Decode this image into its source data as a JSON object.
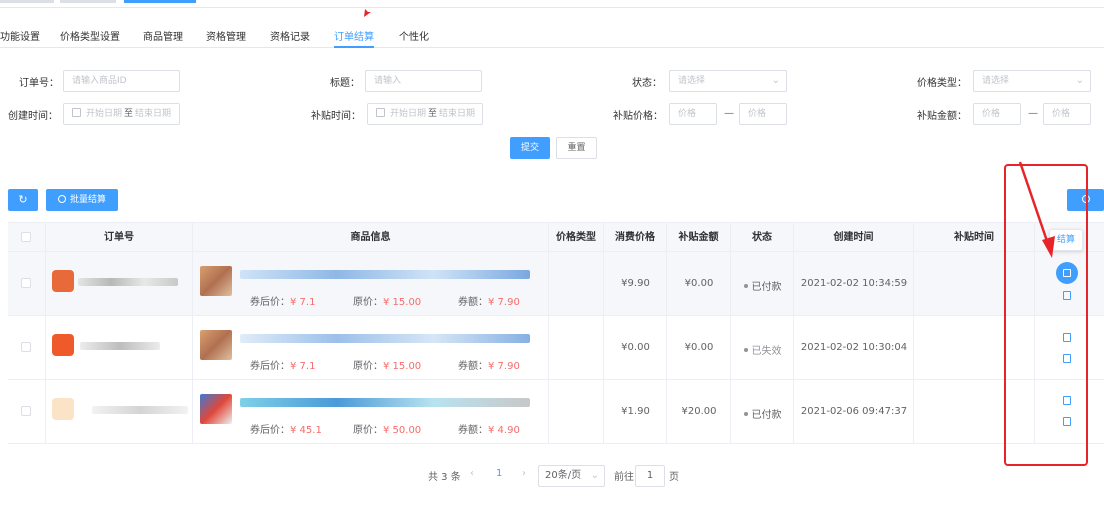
{
  "tabs": [
    {
      "label": "功能设置",
      "active": false
    },
    {
      "label": "价格类型设置",
      "active": false
    },
    {
      "label": "商品管理",
      "active": false
    },
    {
      "label": "资格管理",
      "active": false
    },
    {
      "label": "资格记录",
      "active": false
    },
    {
      "label": "订单结算",
      "active": true
    },
    {
      "label": "个性化",
      "active": false
    }
  ],
  "filters": {
    "order_no": {
      "label": "订单号：",
      "placeholder": "请输入商品ID"
    },
    "title": {
      "label": "标题：",
      "placeholder": "请输入"
    },
    "status": {
      "label": "状态：",
      "placeholder": "请选择"
    },
    "price_type": {
      "label": "价格类型：",
      "placeholder": "请选择"
    },
    "created_time": {
      "label": "创建时间：",
      "start": "开始日期",
      "to": "至",
      "end": "结束日期"
    },
    "subsidy_time": {
      "label": "补贴时间：",
      "start": "开始日期",
      "to": "至",
      "end": "结束日期"
    },
    "subsidy_price": {
      "label": "补贴价格：",
      "min_placeholder": "价格",
      "dash": "—",
      "max_placeholder": "价格"
    },
    "subsidy_amount": {
      "label": "补贴金额：",
      "min_placeholder": "价格",
      "dash": "—",
      "max_placeholder": "价格"
    }
  },
  "actions": {
    "submit": "提交",
    "reset": "重置",
    "batch_settle": "批量结算"
  },
  "icons": {
    "refresh": "refresh-icon",
    "user": "user-icon",
    "search": "search-icon",
    "settle": "settle-icon",
    "detail": "detail-icon"
  },
  "table": {
    "columns": [
      "订单号",
      "商品信息",
      "价格类型",
      "消费价格",
      "补贴金额",
      "状态",
      "创建时间",
      "补贴时间"
    ],
    "rows": [
      {
        "after_coupon_label": "券后价：",
        "after_coupon": "¥ 7.1",
        "original_label": "原价：",
        "original": "¥ 15.00",
        "coupon_label": "券额：",
        "coupon": "¥ 7.90",
        "consume_price": "¥9.90",
        "subsidy_amount": "¥0.00",
        "status": "已付款",
        "created": "2021-02-02 10:34:59",
        "subsidy_time": ""
      },
      {
        "after_coupon_label": "券后价：",
        "after_coupon": "¥ 7.1",
        "original_label": "原价：",
        "original": "¥ 15.00",
        "coupon_label": "券额：",
        "coupon": "¥ 7.90",
        "consume_price": "¥0.00",
        "subsidy_amount": "¥0.00",
        "status": "已失效",
        "created": "2021-02-02 10:30:04",
        "subsidy_time": ""
      },
      {
        "after_coupon_label": "券后价：",
        "after_coupon": "¥ 45.1",
        "original_label": "原价：",
        "original": "¥ 50.00",
        "coupon_label": "券额：",
        "coupon": "¥ 4.90",
        "consume_price": "¥1.90",
        "subsidy_amount": "¥20.00",
        "status": "已付款",
        "created": "2021-02-06 09:47:37",
        "subsidy_time": ""
      }
    ]
  },
  "tooltip": "结算",
  "pagination": {
    "total": "共 3 条",
    "prev": "‹",
    "page": "1",
    "next": "›",
    "page_size": "20条/页",
    "goto_label": "前往",
    "goto_value": "1",
    "page_unit": "页"
  },
  "colors": {
    "primary": "#409eff",
    "price_red": "#f56c6c",
    "annotation_red": "#e5252a"
  }
}
